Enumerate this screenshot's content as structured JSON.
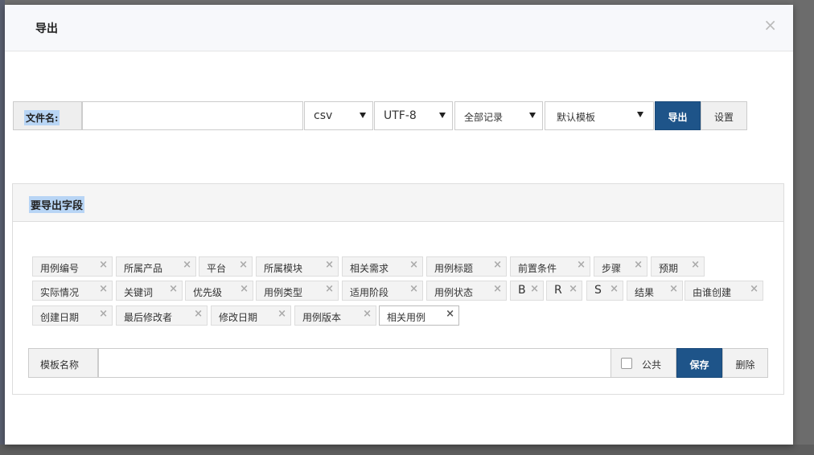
{
  "dialog": {
    "title": "导出",
    "close_glyph": "×"
  },
  "toolbar": {
    "filename_label": "文件名:",
    "filename_value": "",
    "format": "csv",
    "encoding": "UTF-8",
    "range": "全部记录",
    "template": "默认模板",
    "export_label": "导出",
    "settings_label": "设置"
  },
  "fields_panel": {
    "title": "要导出字段",
    "tags": [
      {
        "label": "用例编号"
      },
      {
        "label": "所属产品"
      },
      {
        "label": "平台"
      },
      {
        "label": "所属模块"
      },
      {
        "label": "相关需求"
      },
      {
        "label": "用例标题"
      },
      {
        "label": "前置条件"
      },
      {
        "label": "步骤"
      },
      {
        "label": "预期"
      },
      {
        "label": "实际情况"
      },
      {
        "label": "关键词"
      },
      {
        "label": "优先级"
      },
      {
        "label": "用例类型"
      },
      {
        "label": "适用阶段"
      },
      {
        "label": "用例状态"
      },
      {
        "label": "B"
      },
      {
        "label": "R"
      },
      {
        "label": "S"
      },
      {
        "label": "结果"
      },
      {
        "label": "由谁创建"
      },
      {
        "label": "创建日期"
      },
      {
        "label": "最后修改者"
      },
      {
        "label": "修改日期"
      },
      {
        "label": "用例版本"
      },
      {
        "label": "相关用例"
      }
    ],
    "remove_glyph": "×"
  },
  "template_row": {
    "name_label": "模板名称",
    "name_value": "",
    "public_label": "公共",
    "public_checked": false,
    "save_label": "保存",
    "delete_label": "删除"
  },
  "colors": {
    "primary": "#1e5489",
    "highlight": "#b8d5f5"
  }
}
